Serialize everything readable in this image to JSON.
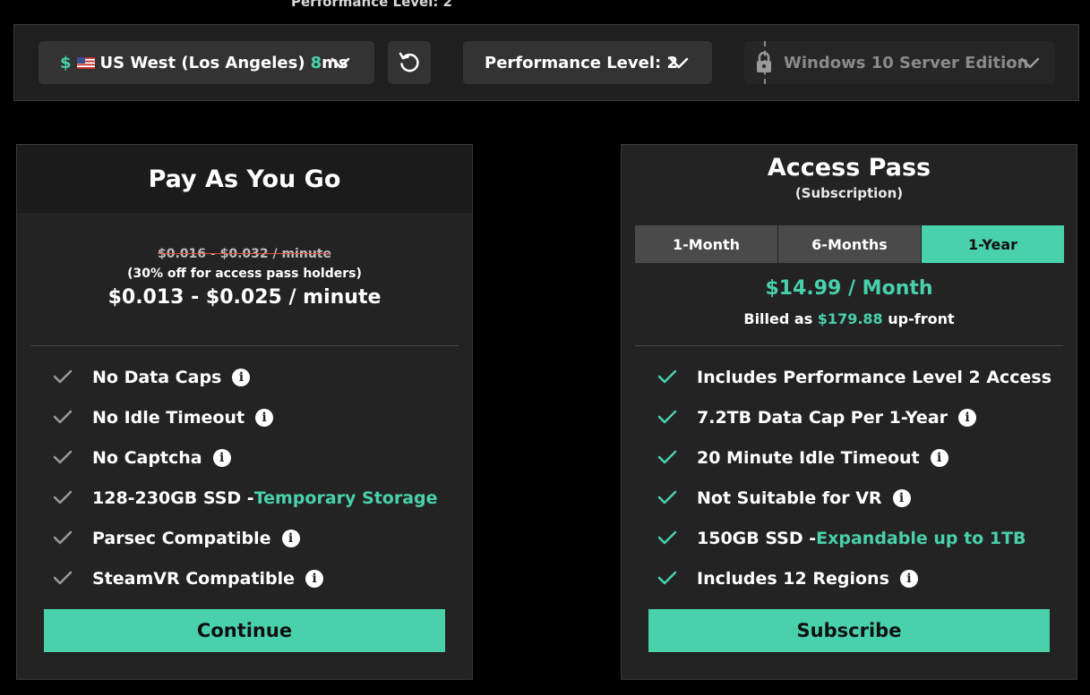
{
  "header_cut": "Performance Level: 2",
  "toolbar": {
    "region": {
      "currency": "$",
      "name": "US West (Los Angeles)",
      "latency_value": "8",
      "latency_unit": "ms"
    },
    "perf": {
      "label": "Performance Level: 2"
    },
    "os": {
      "label": "Windows 10 Server Edition"
    },
    "icons": {
      "reset": "refresh-icon",
      "chevron": "chevron-down-icon",
      "lock": "lock-icon",
      "flag": "us-flag-icon"
    }
  },
  "payg": {
    "title": "Pay As You Go",
    "old_price": "$0.016 - $0.032 / minute",
    "discount_note": "(30% off for access pass holders)",
    "price": "$0.013 - $0.025 / minute",
    "features": [
      {
        "text": "No Data Caps",
        "highlight": "",
        "info": true
      },
      {
        "text": "No Idle Timeout",
        "highlight": "",
        "info": true
      },
      {
        "text": "No Captcha",
        "highlight": "",
        "info": true
      },
      {
        "text": "128-230GB SSD - ",
        "highlight": "Temporary Storage",
        "info": false
      },
      {
        "text": "Parsec Compatible",
        "highlight": "",
        "info": true
      },
      {
        "text": "SteamVR Compatible",
        "highlight": "",
        "info": true
      }
    ],
    "button": "Continue"
  },
  "pass": {
    "title": "Access Pass",
    "subtitle": "(Subscription)",
    "tabs": [
      {
        "label": "1-Month",
        "active": false
      },
      {
        "label": "6-Months",
        "active": false
      },
      {
        "label": "1-Year",
        "active": true
      }
    ],
    "price": "$14.99 / Month",
    "billed_prefix": "Billed as ",
    "billed_amount": "$179.88",
    "billed_suffix": " up-front",
    "features": [
      {
        "text": "Includes Performance Level 2 Access",
        "highlight": "",
        "info": false
      },
      {
        "text": "7.2TB Data Cap Per 1-Year",
        "highlight": "",
        "info": true
      },
      {
        "text": "20 Minute Idle Timeout",
        "highlight": "",
        "info": true
      },
      {
        "text": "Not Suitable for VR",
        "highlight": "",
        "info": true
      },
      {
        "text": "150GB SSD - ",
        "highlight": "Expandable up to 1TB",
        "info": false
      },
      {
        "text": "Includes 12 Regions",
        "highlight": "",
        "info": true
      }
    ],
    "button": "Subscribe"
  },
  "info_glyph": "i",
  "colors": {
    "accent": "#48d1ab",
    "check_muted": "#9a9a9a",
    "background": "#000000",
    "panel": "#232323"
  }
}
